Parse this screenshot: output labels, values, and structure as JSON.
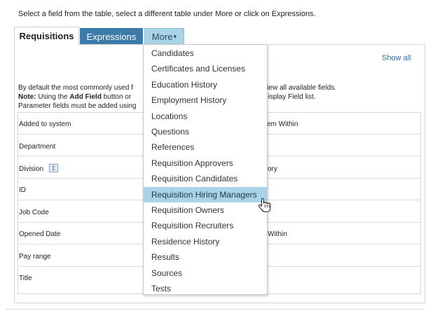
{
  "instructions": "Select a field from the table, select a different table under More or click on Expressions.",
  "tabs": {
    "requisitions": "Requisitions",
    "expressions": "Expressions",
    "more": "More",
    "more_caret": "▾"
  },
  "show_all": "Show all",
  "description": {
    "line1_a": "By default the most commonly used f",
    "line1_b": "o view all available fields.",
    "line2_note": "Note:",
    "line2_a": " Using the ",
    "line2_bold": "Add Field",
    "line2_b": " button or",
    "line2_c": "e Display Field list.",
    "line3": "Parameter fields must be added using"
  },
  "fields": {
    "left": [
      "Added to system",
      "Department",
      "Division",
      "ID",
      "Job Code",
      "Opened Date",
      "Pay range",
      "Title"
    ],
    "right_partial": {
      "added": "em Within",
      "division": "ory",
      "opened": "Within"
    }
  },
  "sigma_icon": "Σ",
  "menu": {
    "items": [
      "Candidates",
      "Certificates and Licenses",
      "Education History",
      "Employment History",
      "Locations",
      "Questions",
      "References",
      "Requisition Approvers",
      "Requisition Candidates",
      "Requisition Hiring Managers",
      "Requisition Owners",
      "Requisition Recruiters",
      "Residence History",
      "Results",
      "Sources",
      "Tests"
    ],
    "highlighted_index": 9
  },
  "colors": {
    "expressions_tab": "#3b7aa9",
    "more_tab": "#a9d3e6",
    "highlight": "#a9d3e6",
    "link": "#2a6fae"
  },
  "cursor_icon": "hand-pointer-icon"
}
